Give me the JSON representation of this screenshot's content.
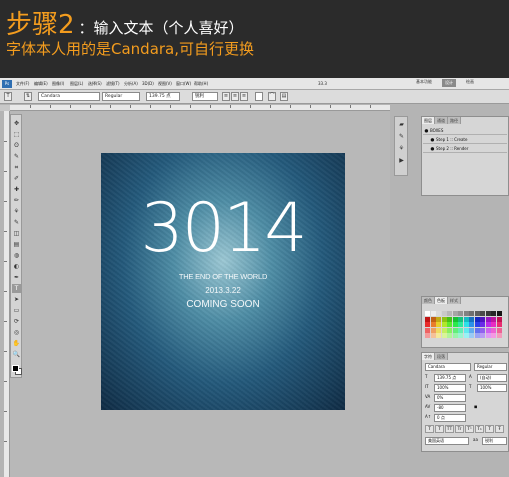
{
  "banner": {
    "step_title": "步骤2",
    "step_subtitle": "：输入文本（个人喜好）",
    "note": "字体本人用的是Candara,可自行更换"
  },
  "menubar": {
    "app_icon": "Ps",
    "items": [
      "文件(F)",
      "编辑(E)",
      "图像(I)",
      "图层(L)",
      "选择(S)",
      "滤镜(T)",
      "分析(A)",
      "3D(D)",
      "视图(V)",
      "窗口(W)",
      "帮助(H)"
    ],
    "zoom": "33.3",
    "workspaces": [
      "基本功能",
      "设计",
      "绘画"
    ]
  },
  "options_bar": {
    "tool_icon": "T",
    "font_family": "Candara",
    "font_style": "Regular",
    "font_size": "139.75 点",
    "antialias": "锐利"
  },
  "toolbox": {
    "icons": [
      "move-icon",
      "marquee-icon",
      "lasso-icon",
      "quick-select-icon",
      "crop-icon",
      "eyedropper-icon",
      "healing-icon",
      "brush-icon",
      "stamp-icon",
      "history-brush-icon",
      "eraser-icon",
      "gradient-icon",
      "blur-icon",
      "dodge-icon",
      "pen-icon",
      "type-icon",
      "path-select-icon",
      "shape-icon",
      "3d-rotate-icon",
      "3d-camera-icon",
      "hand-icon",
      "zoom-icon"
    ],
    "glyphs": [
      "✥",
      "⬚",
      "ʘ",
      "✎",
      "⌗",
      "✐",
      "✚",
      "✏",
      "⚘",
      "✎",
      "◫",
      "▤",
      "◍",
      "◐",
      "✒",
      "T",
      "➤",
      "▭",
      "⟳",
      "◎",
      "✋",
      "🔍"
    ],
    "active_index": 15
  },
  "document": {
    "headline": "3014",
    "line1": "THE END OF THE WORLD",
    "line2": "2013.3.22",
    "line3": "COMING SOON"
  },
  "layers_panel": {
    "tabs": [
      "图层",
      "通道",
      "路径"
    ],
    "rows": [
      {
        "label": "BOXES",
        "eye": "●"
      },
      {
        "label": "Step 1 :: Create",
        "eye": "●"
      },
      {
        "label": "Step 2 :: Render",
        "eye": "●"
      }
    ]
  },
  "swatches_panel": {
    "tabs": [
      "颜色",
      "色板",
      "样式"
    ]
  },
  "character_panel": {
    "tabs": [
      "字符",
      "段落"
    ],
    "font_family": "Candara",
    "font_style": "Regular",
    "font_size": "139.75 点",
    "leading": "(自动)",
    "vertical_scale": "100%",
    "horizontal_scale": "100%",
    "kerning": "0%",
    "tracking": "-80",
    "baseline": "0 点",
    "language": "美国英语",
    "antialias": "锐利",
    "style_buttons": [
      "T",
      "T",
      "TT",
      "Tr",
      "T¹",
      "T₁",
      "T",
      "Ŧ"
    ]
  }
}
